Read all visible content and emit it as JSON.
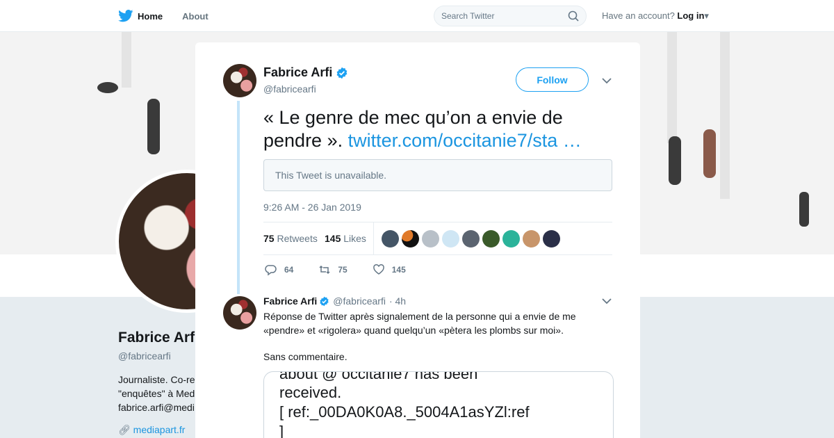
{
  "nav": {
    "home_label": "Home",
    "about_label": "About",
    "search_placeholder": "Search Twitter",
    "account_prompt": "Have an account?",
    "login_label": "Log in"
  },
  "profile": {
    "name": "Fabrice Arfi",
    "handle": "@fabricearfi",
    "bio_lines": [
      "Journaliste. Co-re",
      "\"enquêtes\" à Med",
      "fabrice.arfi@medi"
    ],
    "link": "mediapart.fr"
  },
  "tweet": {
    "author": "Fabrice Arfi",
    "handle": "@fabricearfi",
    "follow_label": "Follow",
    "text": "« Le genre de mec qu’on a envie de pendre ».",
    "link": "twitter.com/occitanie7/sta …",
    "unavailable": "This Tweet is unavailable.",
    "timestamp": "9:26 AM - 26 Jan 2019",
    "retweets_count": "75",
    "retweets_label": "Retweets",
    "likes_count": "145",
    "likes_label": "Likes",
    "reply_count": "64",
    "retweet_action_count": "75",
    "like_action_count": "145"
  },
  "reply": {
    "author": "Fabrice Arfi",
    "handle": "@fabricearfi",
    "time": "· 4h",
    "text": "Réponse de Twitter après signalement de la personne qui a envie de me «pendre» et «rigolera» quand quelqu’un «pètera les plombs sur moi».",
    "text2": "Sans commentaire.",
    "media_line1": "about @ occitanie7 has been",
    "media_line2": "received.",
    "media_line3": "[ ref:_00DA0K0A8._5004A1asYZl:ref",
    "media_line4": "]"
  },
  "colors": {
    "accent": "#1da1f2",
    "link": "#1b95e0",
    "muted": "#657786",
    "backdrop": "#e6ecf0"
  }
}
